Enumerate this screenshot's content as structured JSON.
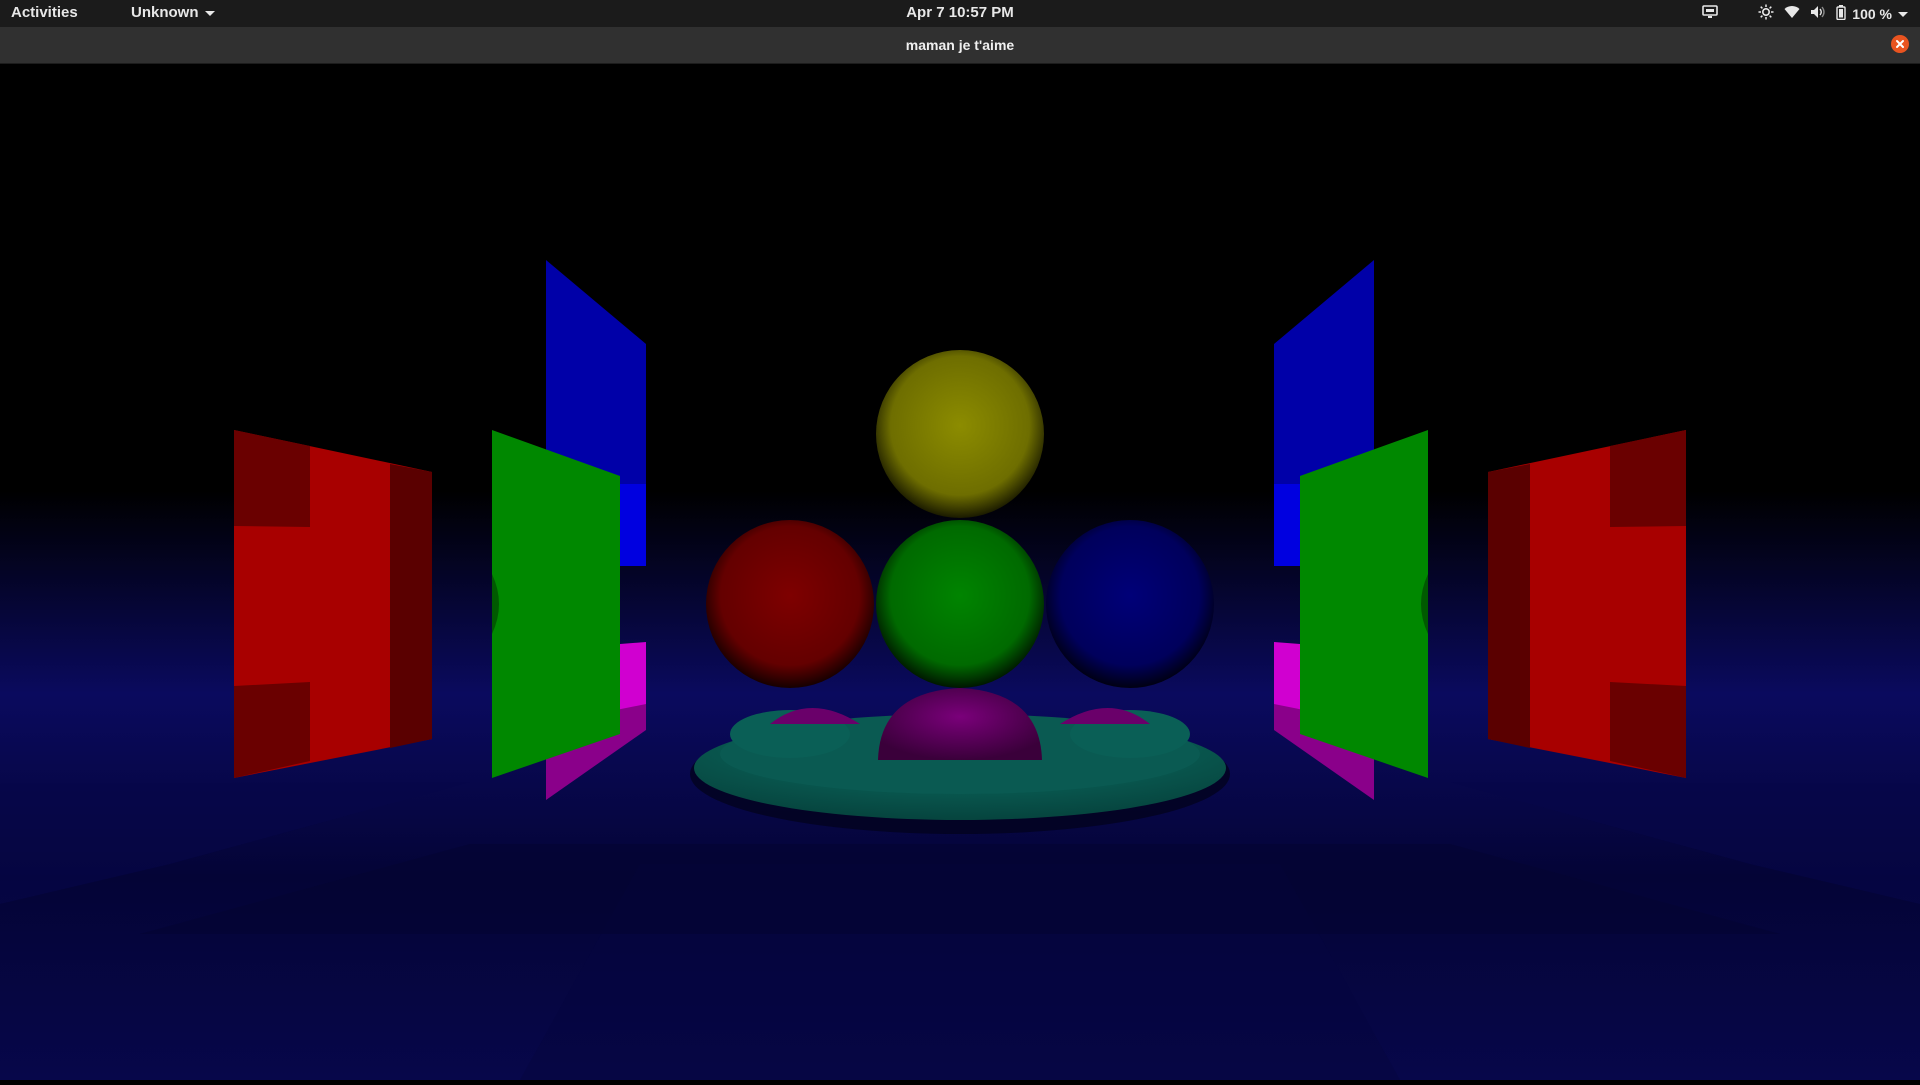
{
  "topbar": {
    "activities_label": "Activities",
    "app_menu_label": "Unknown",
    "clock": "Apr 7  10:57 PM",
    "battery_percent": "100 %",
    "icons": [
      "screen-share-icon",
      "brightness-icon",
      "wifi-icon",
      "volume-icon",
      "battery-icon",
      "system-menu-chevron-icon"
    ]
  },
  "window": {
    "title": "maman je t'aime",
    "close_color": "#e95420"
  },
  "scene": {
    "description_colors": {
      "floor": "#0a0a5a",
      "red_panel": "#a80000",
      "green_panel": "#008800",
      "blue_panel": "#0000b8",
      "magenta_panel": "#c000c0",
      "yellow_sphere": "#8a8a00",
      "red_sphere": "#7a0000",
      "green_sphere": "#007a00",
      "blue_sphere": "#00006a",
      "purple_dome": "#6a006a",
      "teal_disc": "#0a6a60"
    }
  }
}
